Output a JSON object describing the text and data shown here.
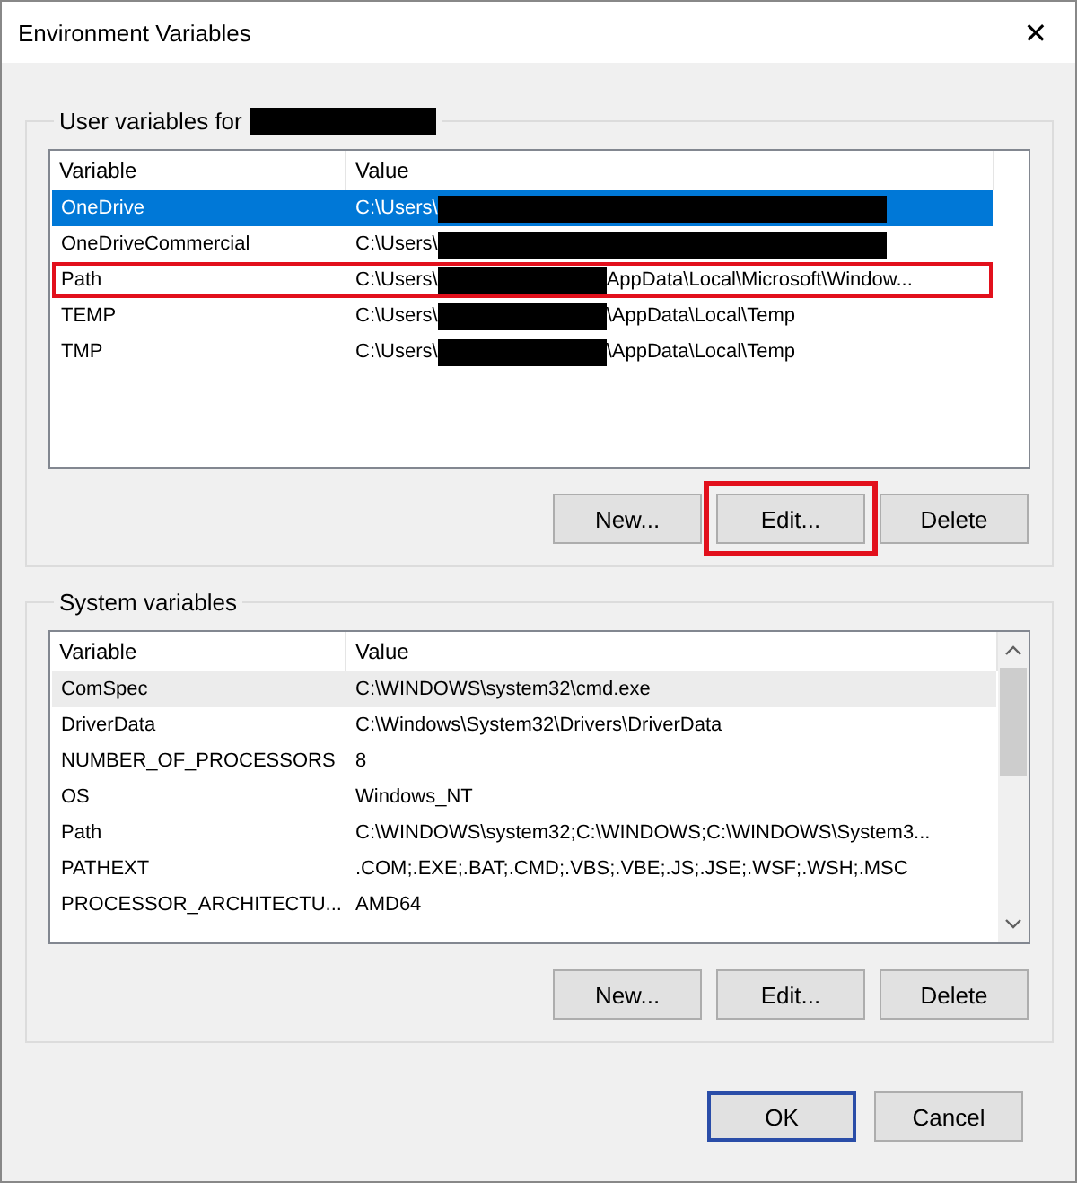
{
  "window": {
    "title": "Environment Variables",
    "close": "✕"
  },
  "user_variables": {
    "label": "User variables for",
    "owner_redacted": true,
    "focused": true,
    "columns": [
      "Variable",
      "Value"
    ],
    "rows": [
      {
        "name": "OneDrive",
        "prefix": "C:\\Users\\",
        "redacted": true,
        "selected": true,
        "highlighted": false
      },
      {
        "name": "OneDriveCommercial",
        "prefix": "C:\\Users\\",
        "redacted": true,
        "selected": false,
        "highlighted": false
      },
      {
        "name": "Path",
        "prefix": "C:\\Users\\",
        "redacted": true,
        "suffix": "AppData\\Local\\Microsoft\\Window...",
        "selected": false,
        "highlighted": true
      },
      {
        "name": "TEMP",
        "prefix": "C:\\Users\\",
        "redacted": true,
        "suffix": "\\AppData\\Local\\Temp",
        "selected": false,
        "highlighted": false
      },
      {
        "name": "TMP",
        "prefix": "C:\\Users\\",
        "redacted": true,
        "suffix": "\\AppData\\Local\\Temp",
        "selected": false,
        "highlighted": false
      }
    ],
    "buttons": [
      {
        "label": "New...",
        "highlighted": false
      },
      {
        "label": "Edit...",
        "highlighted": true
      },
      {
        "label": "Delete",
        "highlighted": false
      }
    ]
  },
  "system_variables": {
    "label": "System variables",
    "focused": false,
    "columns": [
      "Variable",
      "Value"
    ],
    "rows": [
      {
        "name": "ComSpec",
        "prefix": "C:\\WINDOWS\\system32\\cmd.exe",
        "selected": true,
        "highlighted": false
      },
      {
        "name": "DriverData",
        "prefix": "C:\\Windows\\System32\\Drivers\\DriverData",
        "selected": false,
        "highlighted": false
      },
      {
        "name": "NUMBER_OF_PROCESSORS",
        "prefix": "8",
        "selected": false,
        "highlighted": false
      },
      {
        "name": "OS",
        "prefix": "Windows_NT",
        "selected": false,
        "highlighted": false
      },
      {
        "name": "Path",
        "prefix": "C:\\WINDOWS\\system32;C:\\WINDOWS;C:\\WINDOWS\\System3...",
        "selected": false,
        "highlighted": false
      },
      {
        "name": "PATHEXT",
        "prefix": ".COM;.EXE;.BAT;.CMD;.VBS;.VBE;.JS;.JSE;.WSF;.WSH;.MSC",
        "selected": false,
        "highlighted": false
      },
      {
        "name": "PROCESSOR_ARCHITECTU...",
        "prefix": "AMD64",
        "selected": false,
        "highlighted": false
      }
    ],
    "buttons": [
      {
        "label": "New...",
        "highlighted": false
      },
      {
        "label": "Edit...",
        "highlighted": false
      },
      {
        "label": "Delete",
        "highlighted": false
      }
    ]
  },
  "footer_buttons": [
    {
      "label": "OK",
      "default": true
    },
    {
      "label": "Cancel",
      "default": false
    }
  ]
}
